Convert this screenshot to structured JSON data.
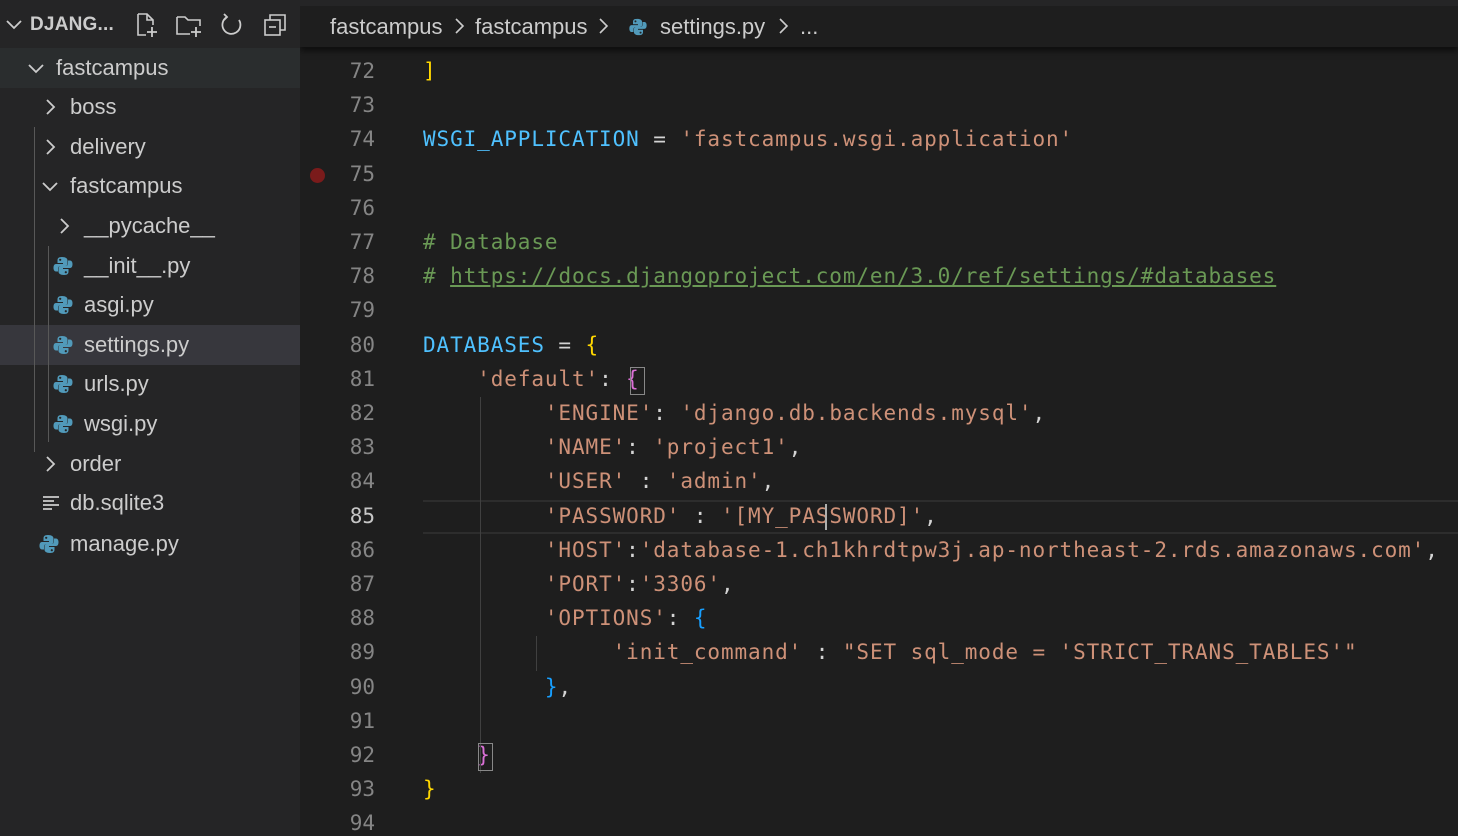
{
  "sidebar": {
    "title": "DJANG...",
    "actions": [
      {
        "name": "new-file-icon"
      },
      {
        "name": "new-folder-icon"
      },
      {
        "name": "refresh-icon"
      },
      {
        "name": "collapse-all-icon"
      }
    ],
    "tree": [
      {
        "label": "fastcampus",
        "type": "folder",
        "expanded": true
      },
      {
        "label": "boss",
        "type": "folder",
        "expanded": false
      },
      {
        "label": "delivery",
        "type": "folder",
        "expanded": false
      },
      {
        "label": "fastcampus",
        "type": "folder",
        "expanded": true
      },
      {
        "label": "__pycache__",
        "type": "folder",
        "expanded": false
      },
      {
        "label": "__init__.py",
        "type": "python"
      },
      {
        "label": "asgi.py",
        "type": "python"
      },
      {
        "label": "settings.py",
        "type": "python",
        "selected": true
      },
      {
        "label": "urls.py",
        "type": "python"
      },
      {
        "label": "wsgi.py",
        "type": "python"
      },
      {
        "label": "order",
        "type": "folder",
        "expanded": false
      },
      {
        "label": "db.sqlite3",
        "type": "text"
      },
      {
        "label": "manage.py",
        "type": "python"
      }
    ]
  },
  "breadcrumb": {
    "items": [
      "fastcampus",
      "fastcampus",
      "settings.py",
      "..."
    ]
  },
  "editor": {
    "current_line": 85,
    "breakpoint_line": 75,
    "line_numbers": [
      "72",
      "73",
      "74",
      "75",
      "76",
      "77",
      "78",
      "79",
      "80",
      "81",
      "82",
      "83",
      "84",
      "85",
      "86",
      "87",
      "88",
      "89",
      "90",
      "91",
      "92",
      "93",
      "94"
    ],
    "code": {
      "l72": [
        "]"
      ],
      "l74": [
        "WSGI_APPLICATION",
        " = ",
        "'fastcampus.wsgi.application'"
      ],
      "l77": [
        "# Database"
      ],
      "l78": [
        "# ",
        "https://docs.djangoproject.com/en/3.0/ref/settings/#databases"
      ],
      "l80": [
        "DATABASES",
        " = ",
        "{"
      ],
      "l81": [
        "'default'",
        ": ",
        "{"
      ],
      "l82": [
        "'ENGINE'",
        ": ",
        "'django.db.backends.mysql'",
        ","
      ],
      "l83": [
        "'NAME'",
        ": ",
        "'project1'",
        ","
      ],
      "l84": [
        "'USER'",
        " : ",
        "'admin'",
        ","
      ],
      "l85": [
        "'PASSWORD'",
        " : ",
        "'[MY_PASSWORD]'",
        ","
      ],
      "l86": [
        "'HOST'",
        ":",
        "'database-1.ch1khrdtpw3j.ap-northeast-2.rds.amazonaws.com'",
        ","
      ],
      "l87": [
        "'PORT'",
        ":",
        "'3306'",
        ","
      ],
      "l88": [
        "'OPTIONS'",
        ": ",
        "{"
      ],
      "l89": [
        "'init_command'",
        " : ",
        "\"SET sql_mode = 'STRICT_TRANS_TABLES'\""
      ],
      "l90": [
        "}",
        ","
      ],
      "l92": [
        "}"
      ],
      "l93": [
        "}"
      ]
    }
  },
  "colors": {
    "background": "#1e1e1e",
    "sidebar": "#252526",
    "selected_row": "#37373d",
    "variable": "#4fc1ff",
    "string": "#ce9178",
    "comment": "#6a9955",
    "bracket_gold": "#ffd700",
    "bracket_orchid": "#da70d6",
    "bracket_blue": "#179fff",
    "python_icon": "#519aba",
    "breakpoint": "#7a1b1b"
  }
}
